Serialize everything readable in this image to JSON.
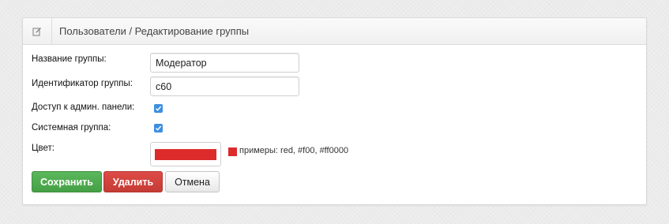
{
  "header": {
    "title": "Пользователи / Редактирование группы",
    "icon": "edit-icon"
  },
  "form": {
    "group_name": {
      "label": "Название группы:",
      "value": "Модератор"
    },
    "group_id": {
      "label": "Идентификатор группы:",
      "value": "c60"
    },
    "admin_access": {
      "label": "Доступ к админ. панели:",
      "checked": true
    },
    "system_group": {
      "label": "Системная группа:",
      "checked": true
    },
    "color": {
      "label": "Цвет:",
      "value": "#dd2a2a",
      "hint": "примеры: red, #f00, #ff0000"
    }
  },
  "actions": {
    "save_label": "Сохранить",
    "delete_label": "Удалить",
    "cancel_label": "Отмена"
  },
  "colors": {
    "accent_checkbox": "#3d8fe0",
    "save": "#4cae4c",
    "delete": "#d9534f"
  }
}
